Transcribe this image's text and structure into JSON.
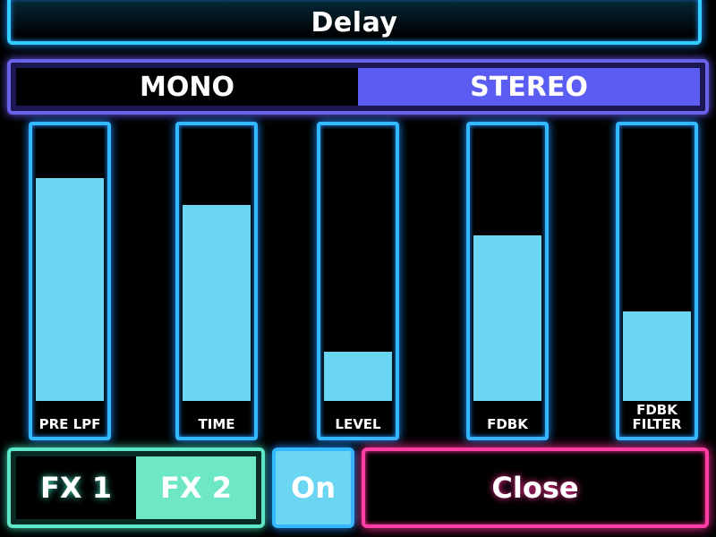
{
  "header": {
    "title": "Delay"
  },
  "mode": {
    "options": [
      {
        "label": "MONO",
        "active": false
      },
      {
        "label": "STEREO",
        "active": true
      }
    ]
  },
  "sliders": [
    {
      "label": "PRE LPF",
      "value": 0.82
    },
    {
      "label": "TIME",
      "value": 0.72
    },
    {
      "label": "LEVEL",
      "value": 0.18
    },
    {
      "label": "FDBK",
      "value": 0.61
    },
    {
      "label": "FDBK\nFILTER",
      "value": 0.33
    }
  ],
  "fx": {
    "options": [
      {
        "label": "FX 1",
        "active": false
      },
      {
        "label": "FX 2",
        "active": true
      }
    ]
  },
  "on_button": {
    "label": "On"
  },
  "close_button": {
    "label": "Close"
  },
  "colors": {
    "slider_fill": "#6ad6f2",
    "accent_blue": "#33b8ff",
    "accent_purple": "#6a62e6",
    "accent_teal": "#5ee6c8",
    "accent_pink": "#ff3fa4"
  }
}
